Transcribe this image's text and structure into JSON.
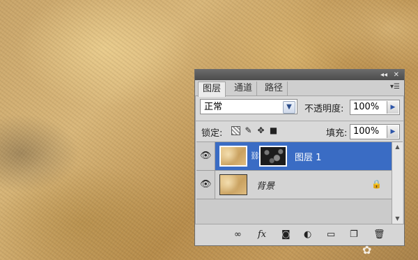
{
  "panel": {
    "title_buttons": {
      "collapse": "◂◂",
      "close": "✕"
    },
    "tabs": [
      {
        "label": "图层",
        "active": true
      },
      {
        "label": "通道",
        "active": false
      },
      {
        "label": "路径",
        "active": false
      }
    ],
    "menu_icon": "▾☰",
    "blend_mode": "正常",
    "opacity_label": "不透明度:",
    "opacity_value": "100%",
    "lock_label": "锁定:",
    "fill_label": "填充:",
    "fill_value": "100%",
    "layers": [
      {
        "name": "图层 1",
        "selected": true,
        "visible": true,
        "has_mask": true
      },
      {
        "name": "背景",
        "selected": false,
        "visible": true,
        "locked": true
      }
    ],
    "bottom_icons": [
      "link-icon",
      "fx-icon",
      "mask-icon",
      "adjustment-icon",
      "folder-icon",
      "new-layer-icon",
      "trash-icon"
    ],
    "selection_color": "#3a6cc4"
  }
}
